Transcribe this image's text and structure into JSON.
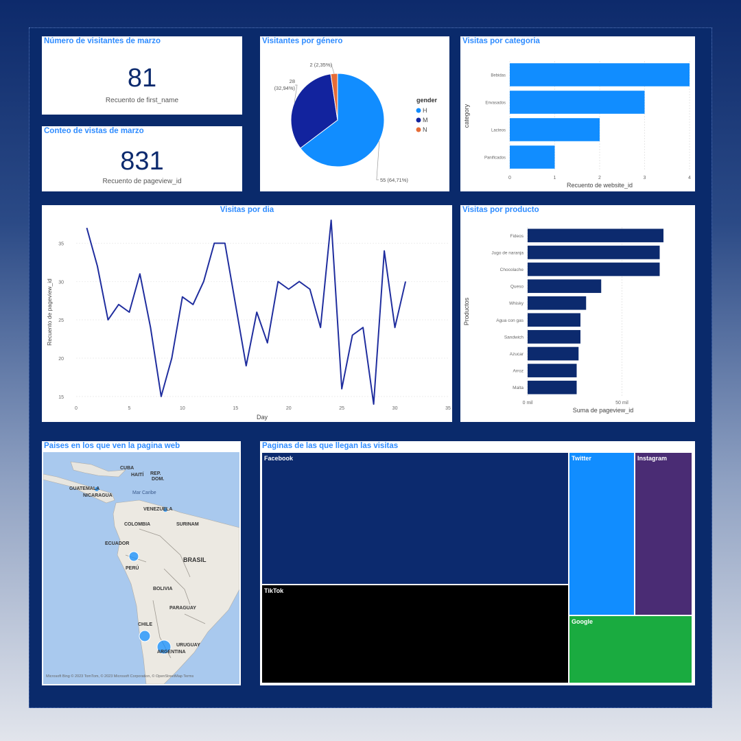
{
  "kpi1": {
    "title": "Número de visitantes de marzo",
    "value": "81",
    "label": "Recuento de first_name"
  },
  "kpi2": {
    "title": "Conteo de vistas de marzo",
    "value": "831",
    "label": "Recuento de pageview_id"
  },
  "gender_chart": {
    "title": "Visitantes por género",
    "legend_title": "gender",
    "chart_data": {
      "type": "pie",
      "categories": [
        "H",
        "M",
        "N"
      ],
      "values": [
        55,
        28,
        2
      ],
      "labels": [
        "55 (64,71%)",
        "28 (32,94%)",
        "2 (2,35%)"
      ],
      "colors": [
        "#118dff",
        "#12239e",
        "#e66c37"
      ]
    }
  },
  "category_chart": {
    "title": "Visitas por categoria",
    "chart_data": {
      "type": "bar",
      "orientation": "horizontal",
      "categories": [
        "Bebidas",
        "Envasados",
        "Lacteos",
        "Panificados"
      ],
      "values": [
        4,
        3,
        2,
        1
      ],
      "xlabel": "Recuento de website_id",
      "ylabel": "category",
      "xlim": [
        0,
        4
      ],
      "xticks": [
        "0",
        "1",
        "2",
        "3",
        "4"
      ],
      "color": "#118dff"
    }
  },
  "daily_chart": {
    "title": "Visitas por dia",
    "chart_data": {
      "type": "line",
      "x": [
        1,
        2,
        3,
        4,
        5,
        6,
        7,
        8,
        9,
        10,
        11,
        12,
        13,
        14,
        15,
        16,
        17,
        18,
        19,
        20,
        21,
        22,
        23,
        24,
        25,
        26,
        27,
        28,
        29,
        30,
        31
      ],
      "values": [
        37,
        32,
        25,
        27,
        26,
        31,
        24,
        15,
        20,
        28,
        27,
        30,
        35,
        35,
        27,
        19,
        26,
        22,
        30,
        29,
        30,
        29,
        24,
        38,
        16,
        23,
        24,
        14,
        34,
        24,
        30
      ],
      "xlabel": "Day",
      "ylabel": "Recuento de pageview_id",
      "xlim": [
        0,
        35
      ],
      "ylim": [
        14,
        38
      ],
      "xticks": [
        "0",
        "5",
        "10",
        "15",
        "20",
        "25",
        "30",
        "35"
      ],
      "yticks": [
        "15",
        "20",
        "25",
        "30",
        "35"
      ],
      "color": "#1f2d9e"
    }
  },
  "product_chart": {
    "title": "Visitas por producto",
    "chart_data": {
      "type": "bar",
      "orientation": "horizontal",
      "categories": [
        "Fideos",
        "Jugo de naranja",
        "Chocolache",
        "Queso",
        "Whisky",
        "Agua con gas",
        "Sandwich",
        "Azucar",
        "Arroz",
        "Malta"
      ],
      "values": [
        72,
        70,
        70,
        39,
        31,
        28,
        28,
        27,
        26,
        26
      ],
      "xlabel": "Suma de pageview_id",
      "ylabel": "Productos",
      "xlim": [
        0,
        80
      ],
      "xticks": [
        "0 mil",
        "50 mil"
      ],
      "color": "#0c2a6e"
    }
  },
  "map_panel": {
    "title": "Paises en los que ven la pagina web",
    "labels": [
      "CUBA",
      "HAITÍ",
      "REP.",
      "DOM.",
      "GUATEMALA",
      "NICARAGUA",
      "Mar Caribe",
      "VENEZUELA",
      "COLOMBIA",
      "SURINAM",
      "ECUADOR",
      "PERÚ",
      "BRASIL",
      "BOLIVIA",
      "PARAGUAY",
      "CHILE",
      "URUGUAY",
      "ARGENTINA"
    ],
    "attribution": "Microsoft Bing   © 2023 TomTom, © 2023 Microsoft Corporation, © OpenStreetMap   Terms"
  },
  "treemap": {
    "title": "Paginas de las que llegan las visitas",
    "chart_data": {
      "type": "treemap",
      "categories": [
        "Facebook",
        "TikTok",
        "Twitter",
        "Instagram",
        "Google"
      ],
      "colors": [
        "#0c2a6e",
        "#000000",
        "#118dff",
        "#4a2c74",
        "#1aab40"
      ]
    }
  }
}
